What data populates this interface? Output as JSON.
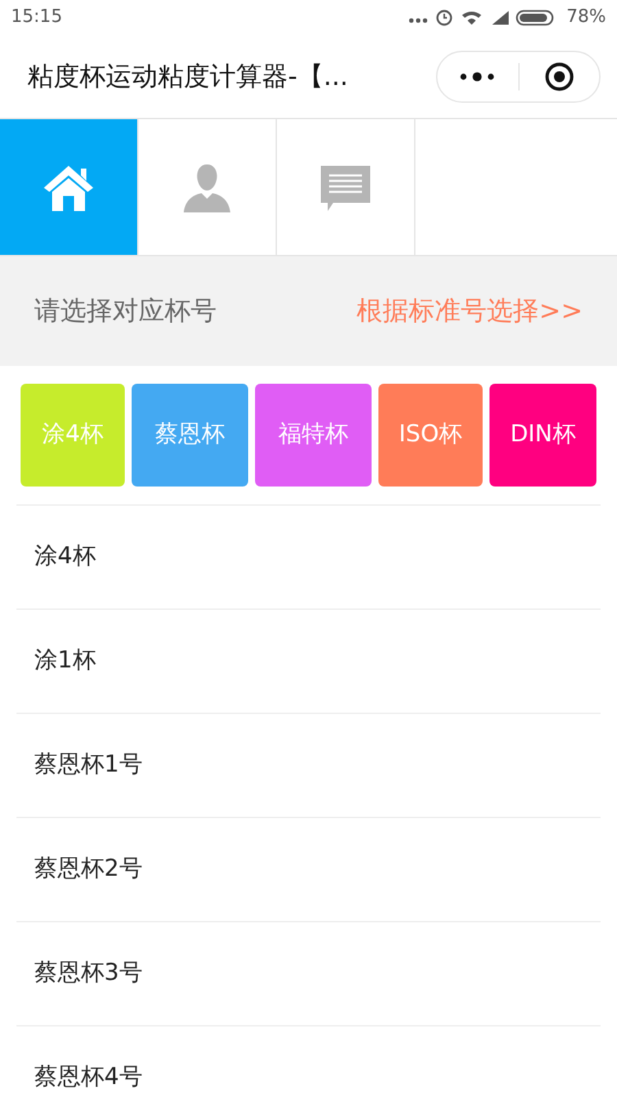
{
  "status_bar": {
    "time": "15:15",
    "battery": "78%"
  },
  "header": {
    "title": "粘度杯运动粘度计算器-【..."
  },
  "tabs": [
    {
      "selected": true
    },
    {
      "selected": false
    },
    {
      "selected": false
    }
  ],
  "filter_bar": {
    "label": "请选择对应杯号",
    "link": "根据标准号选择>>"
  },
  "categories": [
    {
      "label": "涂4杯",
      "color": "#c6ec2c"
    },
    {
      "label": "蔡恩杯",
      "color": "#44a9f2"
    },
    {
      "label": "福特杯",
      "color": "#e05df5"
    },
    {
      "label": "ISO杯",
      "color": "#ff7c58"
    },
    {
      "label": "DIN杯",
      "color": "#ff0080"
    }
  ],
  "items": [
    "涂4杯",
    "涂1杯",
    "蔡恩杯1号",
    "蔡恩杯2号",
    "蔡恩杯3号",
    "蔡恩杯4号"
  ]
}
